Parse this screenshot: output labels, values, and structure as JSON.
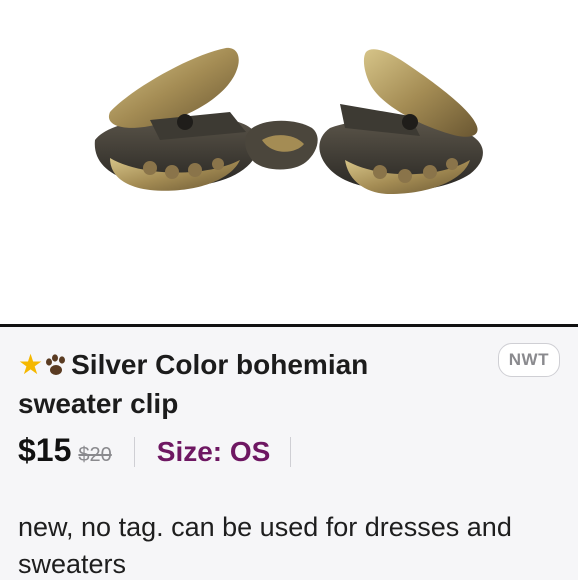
{
  "listing": {
    "title": "Silver Color bohemian sweater clip",
    "condition_badge": "NWT",
    "price": "$15",
    "original_price": "$20",
    "size_label": "Size: OS",
    "description": "new, no tag.  can be used for dresses and sweaters",
    "title_icons": [
      "star-icon",
      "paw-icon"
    ],
    "image_alt": "antique bronze sweater clip"
  },
  "colors": {
    "size_accent": "#6e1762",
    "bronze": "#9c8552",
    "star": "#f5b800"
  }
}
